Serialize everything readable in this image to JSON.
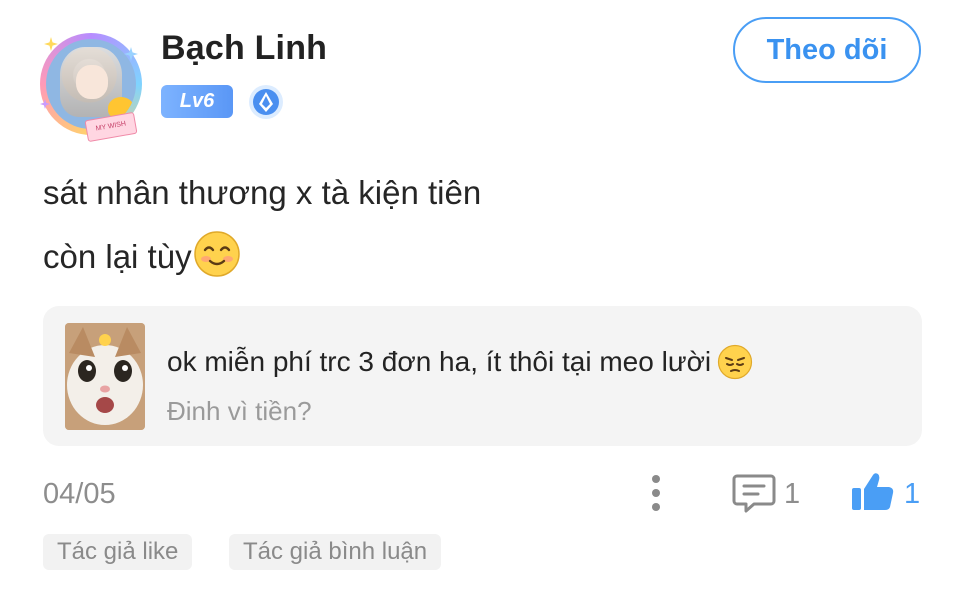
{
  "author": {
    "name": "Bạch Linh",
    "level": "Lv6",
    "avatar_tag_text": "MY WISH"
  },
  "follow_button_label": "Theo dõi",
  "post": {
    "line1": "sát nhân thương x tà kiện tiên",
    "line2": "còn lại tùy"
  },
  "quote": {
    "text": "ok miễn phí trc 3 đơn ha, ít thôi tại meo lười",
    "author": "Đinh vì tiền?"
  },
  "footer": {
    "date": "04/05",
    "comment_count": "1",
    "like_count": "1"
  },
  "tags": [
    "Tác giả like",
    "Tác giả bình luận"
  ],
  "colors": {
    "accent": "#4a9ef5",
    "level_badge": "#5a97f6",
    "card_bg": "#f4f4f4",
    "muted_text": "#8d8d8d"
  },
  "icons": {
    "more": "vertical-dots-icon",
    "comment": "comment-icon",
    "like": "thumbs-up-icon",
    "verify": "verified-badge-icon",
    "post_emoji": "smiling-face-emoji",
    "quote_emoji": "pensive-face-emoji"
  }
}
